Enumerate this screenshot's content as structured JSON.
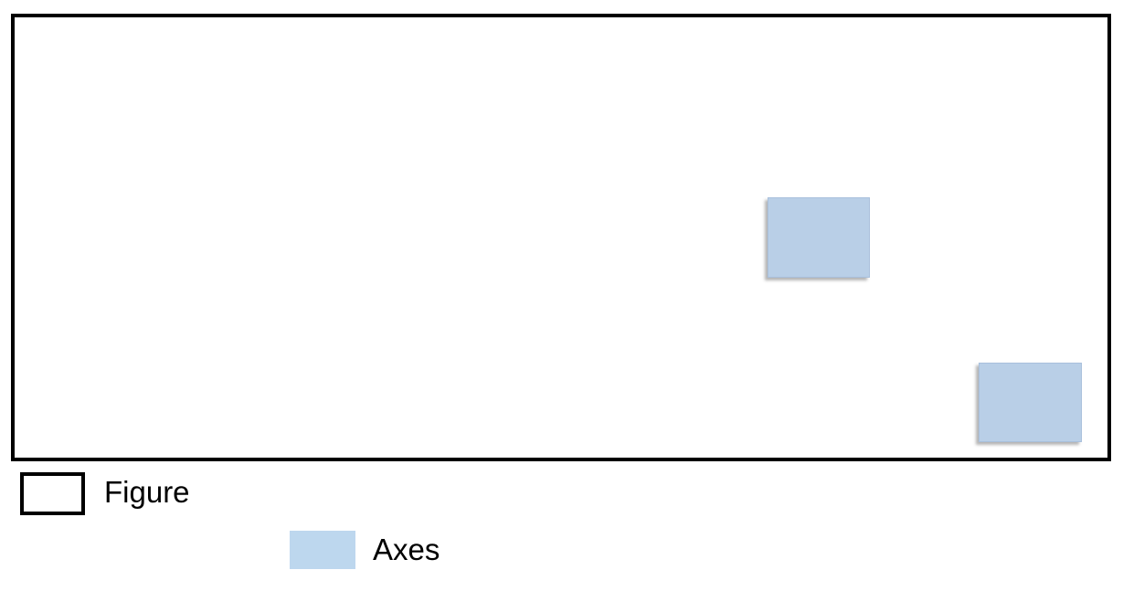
{
  "diagram": {
    "figure": {
      "border_color": "#000000",
      "fill": "#ffffff"
    },
    "axes": [
      {
        "fill": "#b9cfe7"
      },
      {
        "fill": "#b9cfe7"
      }
    ]
  },
  "legend": {
    "figure_label": "Figure",
    "axes_label": "Axes",
    "axes_swatch_color": "#bdd7ee",
    "figure_swatch_border": "#000000"
  }
}
